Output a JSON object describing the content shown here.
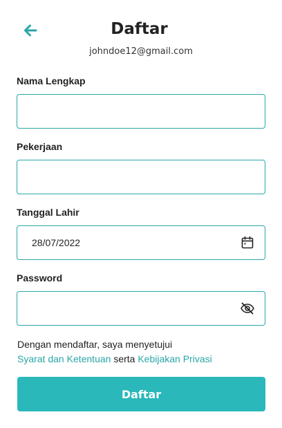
{
  "header": {
    "title": "Daftar",
    "email": "johndoe12@gmail.com",
    "back_icon": "arrow-left-icon"
  },
  "form": {
    "full_name": {
      "label": "Nama Lengkap",
      "value": "",
      "placeholder": ""
    },
    "occupation": {
      "label": "Pekerjaan",
      "value": "",
      "placeholder": ""
    },
    "birth_date": {
      "label": "Tanggal Lahir",
      "value": "28/07/2022",
      "icon": "calendar-icon"
    },
    "password": {
      "label": "Password",
      "value": "",
      "placeholder": "",
      "icon": "eye-off-icon"
    }
  },
  "terms": {
    "prefix": "Dengan mendaftar, saya menyetujui",
    "terms_link": "Syarat dan Ketentuan",
    "conjunction": "serta",
    "privacy_link": "Kebijakan Privasi"
  },
  "submit_label": "Daftar",
  "colors": {
    "accent": "#2aa6a8",
    "button": "#2ab8ba"
  }
}
